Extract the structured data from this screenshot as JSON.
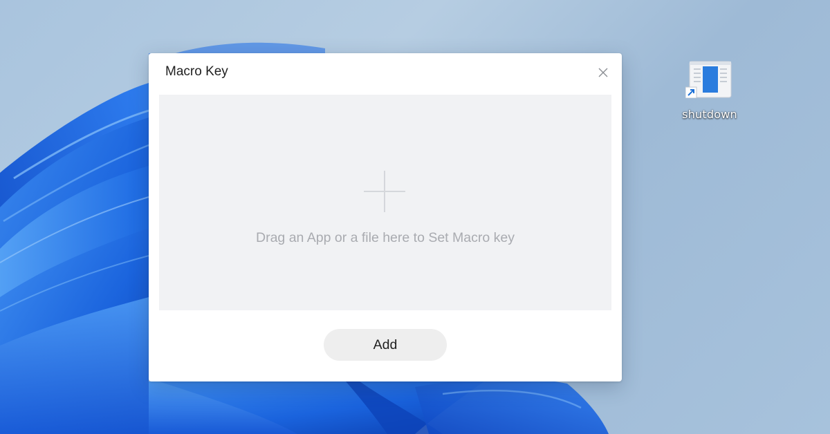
{
  "dialog": {
    "title": "Macro Key",
    "drop_hint": "Drag an App or a file here to Set Macro key",
    "add_label": "Add"
  },
  "desktop": {
    "icons": [
      {
        "label": "shutdown",
        "icon": "shortcut-icon"
      }
    ]
  },
  "colors": {
    "accent_blue": "#1a6fd6",
    "drop_zone_bg": "#f1f2f4",
    "button_bg": "#eeeeee"
  }
}
